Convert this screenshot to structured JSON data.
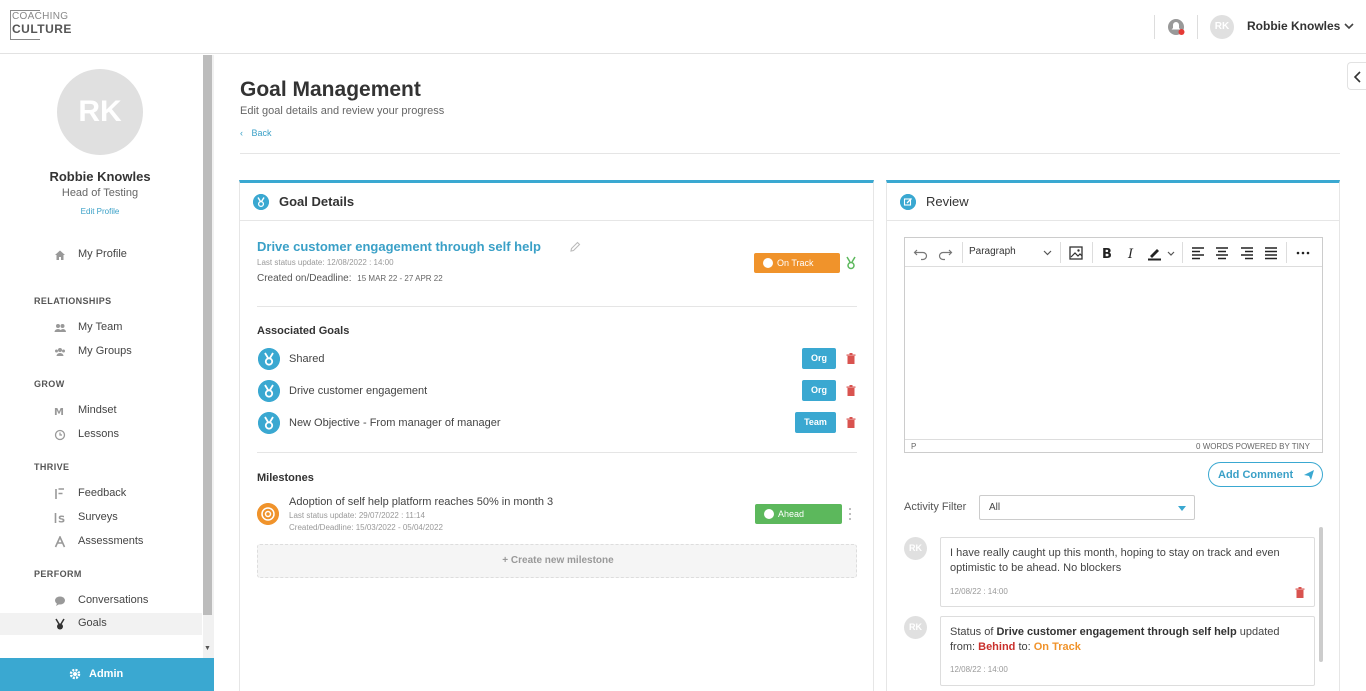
{
  "logo": {
    "line1": "COACHING",
    "line2": "CULTURE"
  },
  "header": {
    "user_initials": "RK",
    "user_name": "Robbie Knowles"
  },
  "sidebar": {
    "avatar_initials": "RK",
    "name": "Robbie Knowles",
    "role": "Head of Testing",
    "edit_profile": "Edit Profile",
    "my_profile": "My Profile",
    "sections": {
      "relationships": "RELATIONSHIPS",
      "grow": "GROW",
      "thrive": "THRIVE",
      "perform": "PERFORM"
    },
    "items": {
      "my_team": "My Team",
      "my_groups": "My Groups",
      "mindset": "Mindset",
      "lessons": "Lessons",
      "feedback": "Feedback",
      "surveys": "Surveys",
      "assessments": "Assessments",
      "conversations": "Conversations",
      "goals": "Goals"
    },
    "admin": "Admin"
  },
  "page": {
    "title": "Goal Management",
    "subtitle": "Edit goal details and review your progress",
    "back": "Back"
  },
  "goal_details": {
    "heading": "Goal Details",
    "title": "Drive customer engagement through self help",
    "last_update": "Last status update: 12/08/2022 : 14:00",
    "created_label": "Created on/Deadline:",
    "created_value": "15 MAR 22 - 27 APR 22",
    "status": "On Track",
    "associated_heading": "Associated Goals",
    "associated": [
      {
        "name": "Shared",
        "tag": "Org"
      },
      {
        "name": "Drive customer engagement",
        "tag": "Org"
      },
      {
        "name": "New Objective - From manager of manager",
        "tag": "Team"
      }
    ],
    "milestones_heading": "Milestones",
    "milestone": {
      "title": "Adoption of self help platform reaches 50% in month 3",
      "last_update": "Last status update: 29/07/2022 : 11:14",
      "created": "Created/Deadline: 15/03/2022 - 05/04/2022",
      "status": "Ahead"
    },
    "create_milestone": "+ Create new milestone"
  },
  "review": {
    "heading": "Review",
    "paragraph": "Paragraph",
    "status_left": "P",
    "status_right": "0 WORDS  POWERED BY TINY",
    "add_comment": "Add Comment",
    "activity_filter_label": "Activity Filter",
    "activity_filter_value": "All",
    "comments": [
      {
        "initials": "RK",
        "text": "I have really caught up this month, hoping to stay on track and even optimistic to be ahead. No blockers",
        "time": "12/08/22 : 14:00"
      },
      {
        "initials": "RK",
        "prefix": "Status of ",
        "goal": "Drive customer engagement through self help",
        "mid": " updated from: ",
        "from": "Behind",
        "to_label": " to: ",
        "to": "On Track",
        "time": "12/08/22 : 14:00"
      }
    ]
  },
  "colors": {
    "accent": "#3aa8d1",
    "on_track": "#f0932b",
    "ahead": "#5cb85c",
    "danger": "#d9534f"
  }
}
